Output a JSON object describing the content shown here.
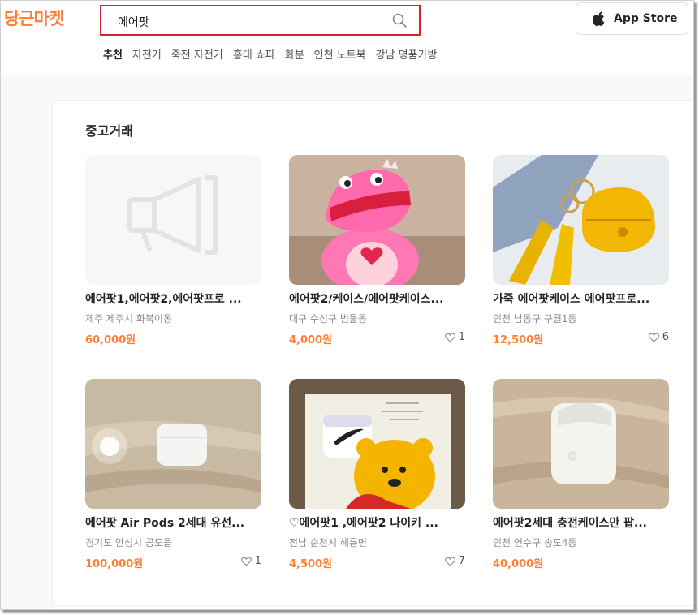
{
  "header": {
    "logo": "당근마켓",
    "search": {
      "value": "에어팟"
    },
    "app_store_label": "App Store",
    "keywords": [
      "추천",
      "자전거",
      "죽전 자전거",
      "홍대 쇼파",
      "화분",
      "인천 노트북",
      "강남 명품가방"
    ]
  },
  "section": {
    "title": "중고거래"
  },
  "colors": {
    "brand": "#ff7e36",
    "search_border": "#d9232e"
  },
  "items": [
    {
      "title": "에어팟1,에어팟2,에어팟프로 ...",
      "region": "제주 제주시 화북이동",
      "price": "60,000원",
      "likes": "",
      "image": "placeholder-megaphone-icon"
    },
    {
      "title": "에어팟2/케이스/에어팟케이스...",
      "region": "대구 수성구 범물동",
      "price": "4,000원",
      "likes": "1",
      "image": "pink-dinosaur-case"
    },
    {
      "title": "가죽 에어팟케이스 에어팟프로...",
      "region": "인천 남동구 구월1동",
      "price": "12,500원",
      "likes": "6",
      "image": "yellow-leather-case"
    },
    {
      "title": "에어팟 Air Pods 2세대 유선...",
      "region": "경기도 안성시 공도읍",
      "price": "100,000원",
      "likes": "1",
      "image": "white-airpods-case"
    },
    {
      "title": "♡에어팟1 ,에어팟2 나이키 ...",
      "region": "전남 순천시 해룡면",
      "price": "4,500원",
      "likes": "7",
      "image": "pooh-book-case"
    },
    {
      "title": "에어팟2세대 충전케이스만 팝...",
      "region": "인천 연수구 송도4동",
      "price": "40,000원",
      "likes": "",
      "image": "white-airpods-case-open"
    }
  ]
}
